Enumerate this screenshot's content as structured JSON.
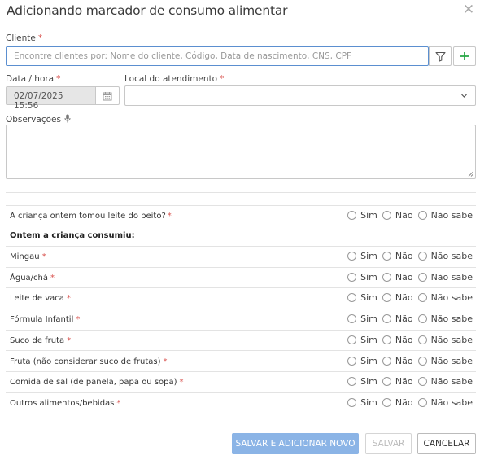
{
  "dialog": {
    "title": "Adicionando marcador de consumo alimentar"
  },
  "client": {
    "label": "Cliente",
    "required_mark": "*",
    "placeholder": "Encontre clientes por: Nome do cliente, Código, Data de nascimento, CNS, CPF"
  },
  "datetime": {
    "label": "Data / hora",
    "required_mark": "*",
    "value": "02/07/2025 15:56"
  },
  "location": {
    "label": "Local do atendimento",
    "required_mark": "*",
    "value": ""
  },
  "notes": {
    "label": "Observações",
    "value": ""
  },
  "options": {
    "yes": "Sim",
    "no": "Não",
    "dont_know": "Não sabe"
  },
  "questions": {
    "breastfeeding": {
      "label": "A criança ontem tomou leite do peito?",
      "required_mark": "*"
    },
    "section_heading": "Ontem a criança consumiu:",
    "items": [
      {
        "label": "Mingau",
        "required_mark": "*"
      },
      {
        "label": "Água/chá",
        "required_mark": "*"
      },
      {
        "label": "Leite de vaca",
        "required_mark": "*"
      },
      {
        "label": "Fórmula Infantil",
        "required_mark": "*"
      },
      {
        "label": "Suco de fruta",
        "required_mark": "*"
      },
      {
        "label": "Fruta (não considerar suco de frutas)",
        "required_mark": "*"
      },
      {
        "label": "Comida de sal (de panela, papa ou sopa)",
        "required_mark": "*"
      },
      {
        "label": "Outros alimentos/bebidas",
        "required_mark": "*"
      }
    ]
  },
  "footer": {
    "save_and_new": "SALVAR E ADICIONAR NOVO",
    "save": "SALVAR",
    "cancel": "CANCELAR"
  },
  "colors": {
    "primary": "#8bb4e6",
    "required": "#d9534f",
    "add_green": "#28a745",
    "focus_border": "#5b8fd0"
  }
}
